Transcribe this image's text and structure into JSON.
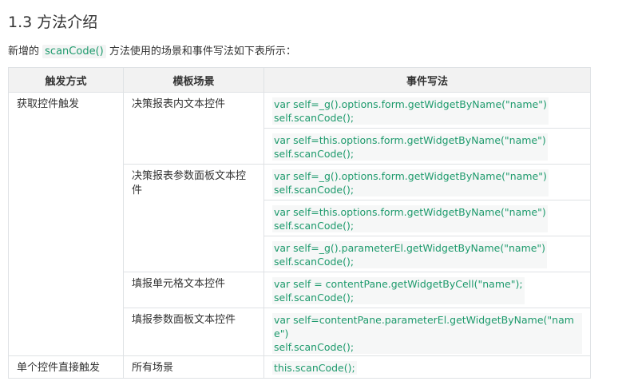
{
  "section": {
    "title": "1.3 方法介绍",
    "intro_prefix": "新增的",
    "intro_code": "scanCode()",
    "intro_suffix": "方法使用的场景和事件写法如下表所示："
  },
  "table": {
    "headers": [
      "触发方式",
      "模板场景",
      "事件写法"
    ],
    "groups": [
      {
        "trigger": "获取控件触发",
        "scenes": [
          {
            "scene": "决策报表内文本控件",
            "codes": [
              [
                "var self=_g().options.form.getWidgetByName(\"name\")",
                "self.scanCode();"
              ],
              [
                "var self=this.options.form.getWidgetByName(\"name\")",
                "self.scanCode();"
              ]
            ]
          },
          {
            "scene": "决策报表参数面板文本控件",
            "codes": [
              [
                "var self=_g().options.form.getWidgetByName(\"name\")",
                "self.scanCode();"
              ],
              [
                "var self=this.options.form.getWidgetByName(\"name\")",
                "self.scanCode();"
              ],
              [
                "var self=_g().parameterEl.getWidgetByName(\"name\")",
                "self.scanCode();"
              ]
            ]
          },
          {
            "scene": "填报单元格文本控件",
            "codes": [
              [
                "var self = contentPane.getWidgetByCell(\"name\");",
                "self.scanCode();"
              ]
            ]
          },
          {
            "scene": "填报参数面板文本控件",
            "codes": [
              [
                "var self=contentPane.parameterEl.getWidgetByName(\"name\")",
                "self.scanCode();"
              ]
            ]
          }
        ]
      },
      {
        "trigger": "单个控件直接触发",
        "scenes": [
          {
            "scene": "所有场景",
            "codes": [
              [
                "this.scanCode();"
              ]
            ]
          }
        ]
      }
    ]
  }
}
